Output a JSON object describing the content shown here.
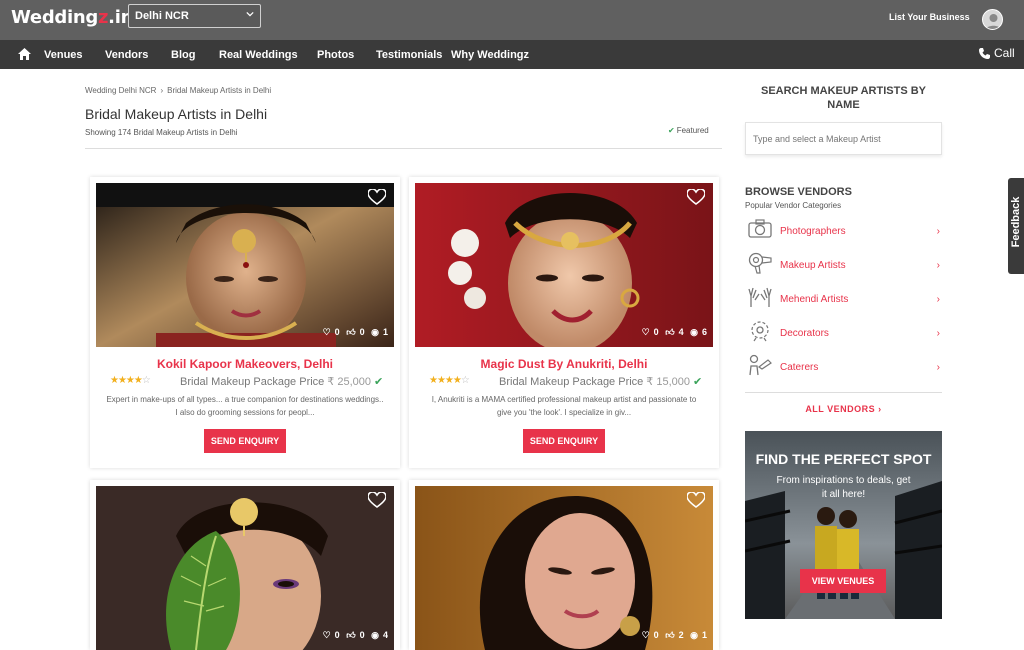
{
  "header": {
    "logo_text": "Wedding",
    "logo_z": "z",
    "logo_tld": ".in",
    "city": "Delhi NCR",
    "list_business": "List Your Business"
  },
  "nav": {
    "items": [
      "Venues",
      "Vendors",
      "Blog",
      "Real Weddings",
      "Photos",
      "Testimonials",
      "Why Weddingz"
    ],
    "call": "Call"
  },
  "breadcrumb": [
    "Wedding Delhi NCR",
    "Bridal Makeup Artists in Delhi"
  ],
  "page": {
    "title": "Bridal Makeup Artists in Delhi",
    "showing": "Showing 174 Bridal Makeup Artists in Delhi",
    "featured": "Featured"
  },
  "cards": [
    {
      "name": "Kokil Kapoor Makeovers, Delhi",
      "rating": 4,
      "price_label": "Bridal Makeup Package Price",
      "price": "₹ 25,000",
      "desc": "Expert in make-ups of all types... a true companion for destinations weddings.. I also do grooming sessions for peopl...",
      "stats": {
        "favs": "0",
        "likes": "0",
        "views": "1"
      },
      "cta": "SEND ENQUIRY"
    },
    {
      "name": "Magic Dust By Anukriti, Delhi",
      "rating": 4,
      "price_label": "Bridal Makeup Package Price",
      "price": "₹ 15,000",
      "desc": "I, Anukriti is a MAMA certified professional makeup artist and passionate to give you 'the look'. I specialize in giv...",
      "stats": {
        "favs": "0",
        "likes": "4",
        "views": "6"
      },
      "cta": "SEND ENQUIRY"
    },
    {
      "stats": {
        "favs": "0",
        "likes": "0",
        "views": "4"
      }
    },
    {
      "stats": {
        "favs": "0",
        "likes": "2",
        "views": "1"
      }
    }
  ],
  "sidebar": {
    "search_title": "SEARCH MAKEUP ARTISTS BY NAME",
    "search_placeholder": "Type and select a Makeup Artist",
    "browse_title": "BROWSE VENDORS",
    "browse_sub": "Popular Vendor Categories",
    "categories": [
      "Photographers",
      "Makeup Artists",
      "Mehendi Artists",
      "Decorators",
      "Caterers"
    ],
    "all_vendors": "ALL VENDORS",
    "promo_title": "FIND THE PERFECT SPOT",
    "promo_sub": "From inspirations to deals, get it all here!",
    "promo_cta": "VIEW VENUES"
  },
  "feedback": "Feedback",
  "colors": {
    "accent": "#e8334a",
    "topbar": "#606060",
    "navbar": "#3a3a3a",
    "star": "#f2b01e",
    "check": "#3aa35a"
  }
}
